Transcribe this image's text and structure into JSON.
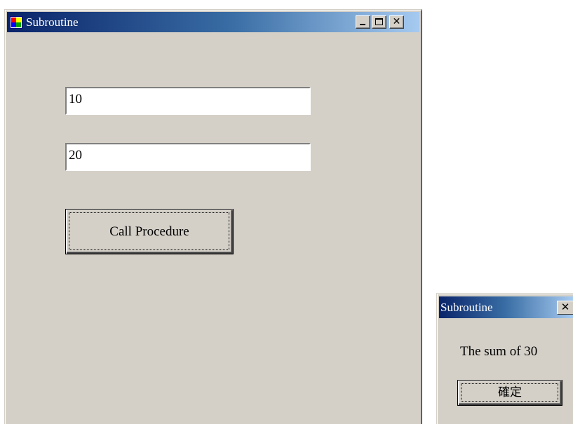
{
  "main_window": {
    "title": "Subroutine",
    "icon": "windows-form-icon",
    "caption_buttons": {
      "minimize": "_",
      "maximize": "□",
      "close": "✕"
    },
    "input_1": {
      "value": "10"
    },
    "input_2": {
      "value": "20"
    },
    "call_button_label": "Call Procedure"
  },
  "message_box": {
    "title": "Subroutine",
    "close_symbol": "✕",
    "message": "The sum of 30",
    "ok_label": "確定"
  },
  "colors": {
    "titlebar_start": "#0a246a",
    "titlebar_end": "#a6caf0",
    "window_face": "#d4d0c8"
  }
}
